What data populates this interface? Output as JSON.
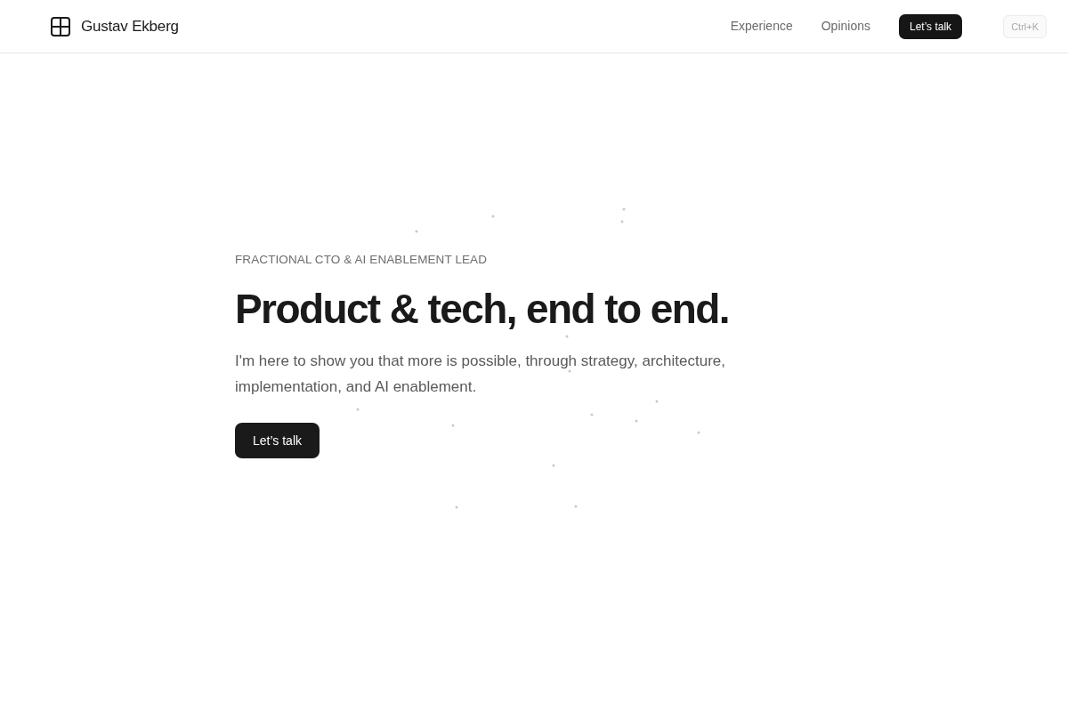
{
  "header": {
    "brand": "Gustav Ekberg",
    "nav_links": [
      "Experience",
      "Opinions"
    ],
    "cta": "Let’s talk",
    "shortcut": "Ctrl+K"
  },
  "hero": {
    "eyebrow": "FRACTIONAL CTO & AI ENABLEMENT LEAD",
    "title": "Product & tech, end to end.",
    "lead": "I'm here to show you that more is possible, through strategy, architecture, implementation, and AI enablement.",
    "button": "Let’s talk"
  }
}
